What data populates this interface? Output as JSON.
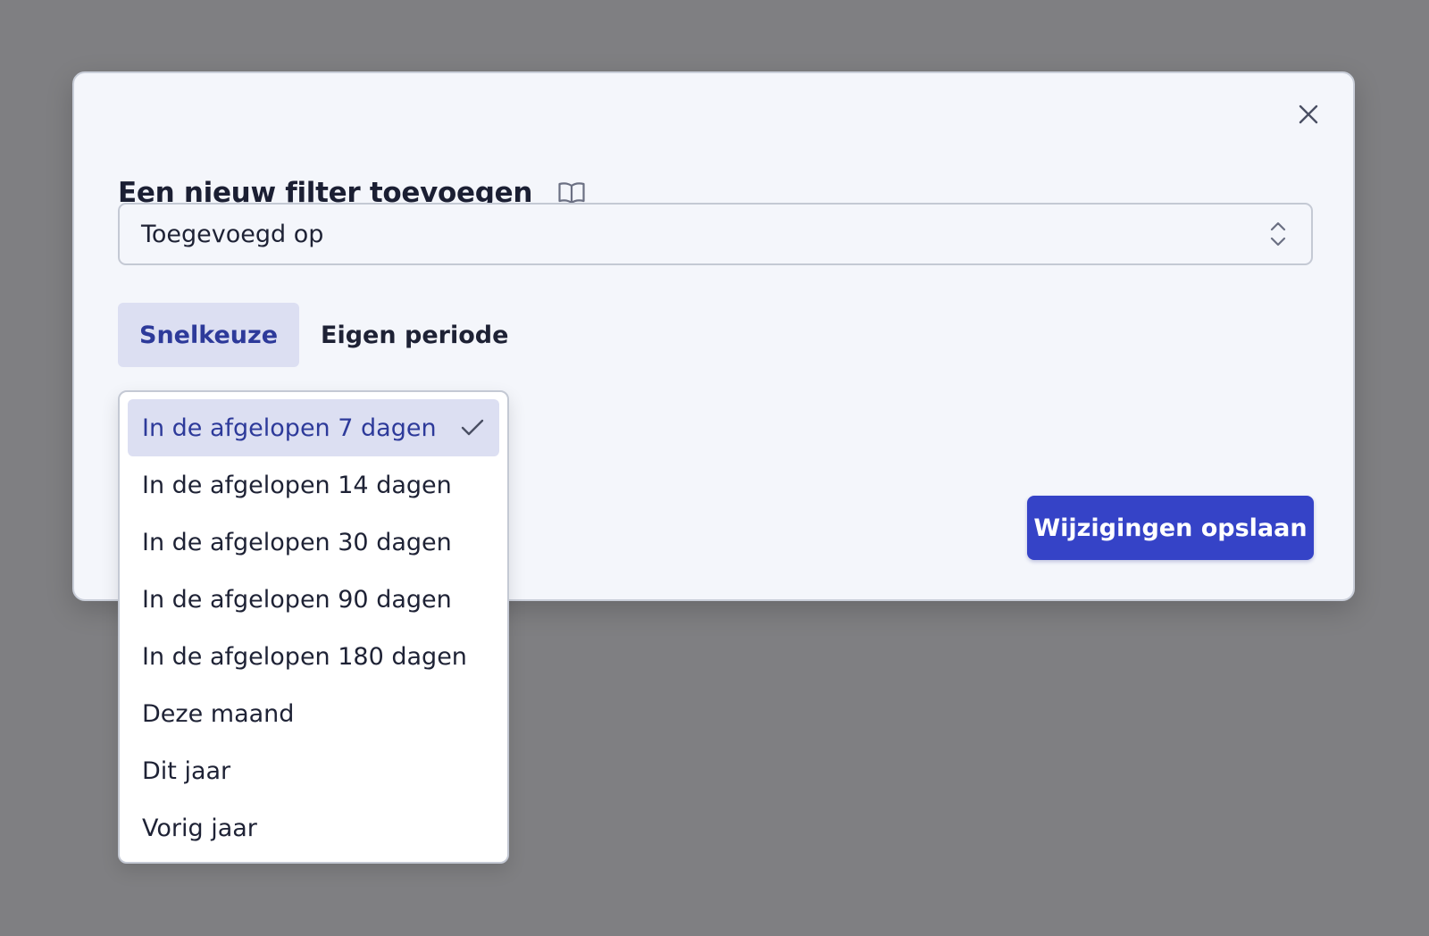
{
  "modal": {
    "title": "Een nieuw filter toevoegen",
    "close_icon": "close-icon",
    "docs_icon": "book-icon"
  },
  "field_select": {
    "value": "Toegevoegd op",
    "icon": "chevron-up-down-icon"
  },
  "tabs": [
    {
      "label": "Snelkeuze",
      "active": true
    },
    {
      "label": "Eigen periode",
      "active": false
    }
  ],
  "dropdown": {
    "options": [
      {
        "label": "In de afgelopen 7 dagen",
        "selected": true
      },
      {
        "label": "In de afgelopen 14 dagen",
        "selected": false
      },
      {
        "label": "In de afgelopen 30 dagen",
        "selected": false
      },
      {
        "label": "In de afgelopen 90 dagen",
        "selected": false
      },
      {
        "label": "In de afgelopen 180 dagen",
        "selected": false
      },
      {
        "label": "Deze maand",
        "selected": false
      },
      {
        "label": "Dit jaar",
        "selected": false
      },
      {
        "label": "Vorig jaar",
        "selected": false
      }
    ],
    "selected_icon": "checkmark-icon"
  },
  "actions": {
    "save_label": "Wijzigingen opslaan"
  },
  "colors": {
    "backdrop": "#7f7f82",
    "modal_bg": "#f4f6fb",
    "accent": "#3543c7",
    "selected_bg": "#dcdff2",
    "selected_text": "#2d3a9a"
  }
}
